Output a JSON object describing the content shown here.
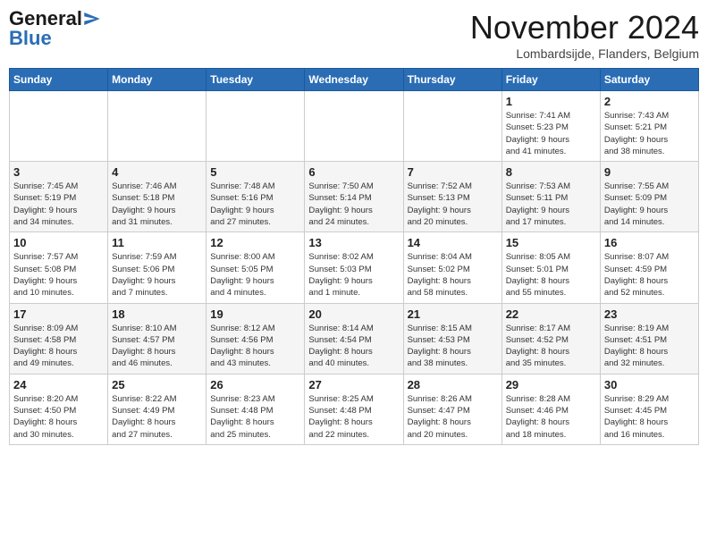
{
  "header": {
    "logo_general": "General",
    "logo_blue": "Blue",
    "month_title": "November 2024",
    "subtitle": "Lombardsijde, Flanders, Belgium"
  },
  "days_of_week": [
    "Sunday",
    "Monday",
    "Tuesday",
    "Wednesday",
    "Thursday",
    "Friday",
    "Saturday"
  ],
  "weeks": [
    [
      {
        "day": "",
        "info": ""
      },
      {
        "day": "",
        "info": ""
      },
      {
        "day": "",
        "info": ""
      },
      {
        "day": "",
        "info": ""
      },
      {
        "day": "",
        "info": ""
      },
      {
        "day": "1",
        "info": "Sunrise: 7:41 AM\nSunset: 5:23 PM\nDaylight: 9 hours\nand 41 minutes."
      },
      {
        "day": "2",
        "info": "Sunrise: 7:43 AM\nSunset: 5:21 PM\nDaylight: 9 hours\nand 38 minutes."
      }
    ],
    [
      {
        "day": "3",
        "info": "Sunrise: 7:45 AM\nSunset: 5:19 PM\nDaylight: 9 hours\nand 34 minutes."
      },
      {
        "day": "4",
        "info": "Sunrise: 7:46 AM\nSunset: 5:18 PM\nDaylight: 9 hours\nand 31 minutes."
      },
      {
        "day": "5",
        "info": "Sunrise: 7:48 AM\nSunset: 5:16 PM\nDaylight: 9 hours\nand 27 minutes."
      },
      {
        "day": "6",
        "info": "Sunrise: 7:50 AM\nSunset: 5:14 PM\nDaylight: 9 hours\nand 24 minutes."
      },
      {
        "day": "7",
        "info": "Sunrise: 7:52 AM\nSunset: 5:13 PM\nDaylight: 9 hours\nand 20 minutes."
      },
      {
        "day": "8",
        "info": "Sunrise: 7:53 AM\nSunset: 5:11 PM\nDaylight: 9 hours\nand 17 minutes."
      },
      {
        "day": "9",
        "info": "Sunrise: 7:55 AM\nSunset: 5:09 PM\nDaylight: 9 hours\nand 14 minutes."
      }
    ],
    [
      {
        "day": "10",
        "info": "Sunrise: 7:57 AM\nSunset: 5:08 PM\nDaylight: 9 hours\nand 10 minutes."
      },
      {
        "day": "11",
        "info": "Sunrise: 7:59 AM\nSunset: 5:06 PM\nDaylight: 9 hours\nand 7 minutes."
      },
      {
        "day": "12",
        "info": "Sunrise: 8:00 AM\nSunset: 5:05 PM\nDaylight: 9 hours\nand 4 minutes."
      },
      {
        "day": "13",
        "info": "Sunrise: 8:02 AM\nSunset: 5:03 PM\nDaylight: 9 hours\nand 1 minute."
      },
      {
        "day": "14",
        "info": "Sunrise: 8:04 AM\nSunset: 5:02 PM\nDaylight: 8 hours\nand 58 minutes."
      },
      {
        "day": "15",
        "info": "Sunrise: 8:05 AM\nSunset: 5:01 PM\nDaylight: 8 hours\nand 55 minutes."
      },
      {
        "day": "16",
        "info": "Sunrise: 8:07 AM\nSunset: 4:59 PM\nDaylight: 8 hours\nand 52 minutes."
      }
    ],
    [
      {
        "day": "17",
        "info": "Sunrise: 8:09 AM\nSunset: 4:58 PM\nDaylight: 8 hours\nand 49 minutes."
      },
      {
        "day": "18",
        "info": "Sunrise: 8:10 AM\nSunset: 4:57 PM\nDaylight: 8 hours\nand 46 minutes."
      },
      {
        "day": "19",
        "info": "Sunrise: 8:12 AM\nSunset: 4:56 PM\nDaylight: 8 hours\nand 43 minutes."
      },
      {
        "day": "20",
        "info": "Sunrise: 8:14 AM\nSunset: 4:54 PM\nDaylight: 8 hours\nand 40 minutes."
      },
      {
        "day": "21",
        "info": "Sunrise: 8:15 AM\nSunset: 4:53 PM\nDaylight: 8 hours\nand 38 minutes."
      },
      {
        "day": "22",
        "info": "Sunrise: 8:17 AM\nSunset: 4:52 PM\nDaylight: 8 hours\nand 35 minutes."
      },
      {
        "day": "23",
        "info": "Sunrise: 8:19 AM\nSunset: 4:51 PM\nDaylight: 8 hours\nand 32 minutes."
      }
    ],
    [
      {
        "day": "24",
        "info": "Sunrise: 8:20 AM\nSunset: 4:50 PM\nDaylight: 8 hours\nand 30 minutes."
      },
      {
        "day": "25",
        "info": "Sunrise: 8:22 AM\nSunset: 4:49 PM\nDaylight: 8 hours\nand 27 minutes."
      },
      {
        "day": "26",
        "info": "Sunrise: 8:23 AM\nSunset: 4:48 PM\nDaylight: 8 hours\nand 25 minutes."
      },
      {
        "day": "27",
        "info": "Sunrise: 8:25 AM\nSunset: 4:48 PM\nDaylight: 8 hours\nand 22 minutes."
      },
      {
        "day": "28",
        "info": "Sunrise: 8:26 AM\nSunset: 4:47 PM\nDaylight: 8 hours\nand 20 minutes."
      },
      {
        "day": "29",
        "info": "Sunrise: 8:28 AM\nSunset: 4:46 PM\nDaylight: 8 hours\nand 18 minutes."
      },
      {
        "day": "30",
        "info": "Sunrise: 8:29 AM\nSunset: 4:45 PM\nDaylight: 8 hours\nand 16 minutes."
      }
    ]
  ]
}
